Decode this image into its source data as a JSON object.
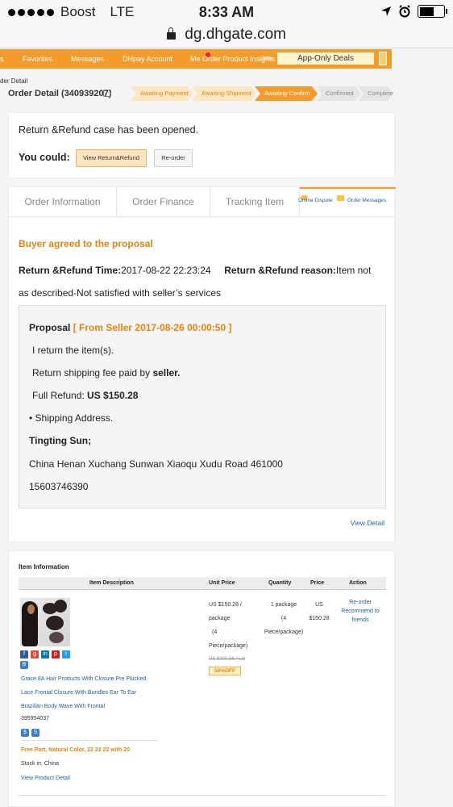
{
  "status_bar": {
    "carrier": "Boost",
    "network": "LTE",
    "time": "8:33 AM"
  },
  "browser": {
    "url": "dg.dhgate.com"
  },
  "nav": {
    "items": [
      "s",
      "Favorites",
      "Messages",
      "DHpay Account",
      "Me  Order Product Insights",
      "beta"
    ],
    "app_only_deals": "App-Only Deals"
  },
  "breadcrumb": "der Detail",
  "order": {
    "title": "Order Detail (340939207)"
  },
  "steps": [
    "Awaiting Payment",
    "Awaiting Shipment",
    "Awaiting Confirm",
    "Confirmed",
    "Complete"
  ],
  "case": {
    "message": "Return &Refund case has been opened.",
    "you_could": "You could:",
    "view_button": "View Return&Refund",
    "reorder_button": "Re-order"
  },
  "tabs": {
    "order_information": "Order Information",
    "order_finance": "Order Finance",
    "tracking": "Tracking Item",
    "online_dispute": "Online Dispute",
    "order_messages": "Order Messages"
  },
  "refund": {
    "status": "Buyer agreed to the proposal",
    "time_label": "Return &Refund Time:",
    "time_value": "2017-08-22 22:23:24",
    "reason_label": "Return &Refund reason:",
    "reason_value_1": "Item not",
    "reason_value_2": "as described-Not satisfied with seller’s services"
  },
  "proposal": {
    "label": "Proposal",
    "source": "[ From Seller 2017-08-26 00:00:50 ]",
    "line1": "I return the item(s).",
    "line2_prefix": "Return shipping fee paid by",
    "line2_bold": "seller.",
    "line3_prefix": "Full Refund:",
    "line3_bold": "US $150.28",
    "line4": "• Shipping Address.",
    "name": "Tingting Sun;",
    "address": "China Henan Xuchang Sunwan Xiaoqu Xudu Road 461000",
    "phone": "15603746390",
    "view_detail": "View Detail"
  },
  "items": {
    "title": "Item Information",
    "headers": [
      "Item Description",
      "Unit Price",
      "Quantity",
      "Price",
      "Action"
    ],
    "product": {
      "description_lines": [
        "Grace 8A Hair Products With Closure Pre Plucked",
        "Lace Frontal Closure With Bundles Ear To Ear",
        "Brazilian Body Wave With Frontal"
      ],
      "sku": "395954037",
      "variant": "Free Part, Natural Color, 22 22 22 with 20",
      "stock": "Stock in: China",
      "view_product": "View Product Detail",
      "unit_price_lines": [
        "US $150.28 /",
        "package",
        "(4",
        "Piece/package)"
      ],
      "old_price": "US $300.56 / Lot",
      "discount": "50%OFF",
      "quantity_lines": [
        "1 package",
        "(4",
        "Piece/package)"
      ],
      "price_lines": [
        "US",
        "$150.28"
      ],
      "action_reorder": "Re-order",
      "action_recommend": "Recommend to friends"
    }
  }
}
